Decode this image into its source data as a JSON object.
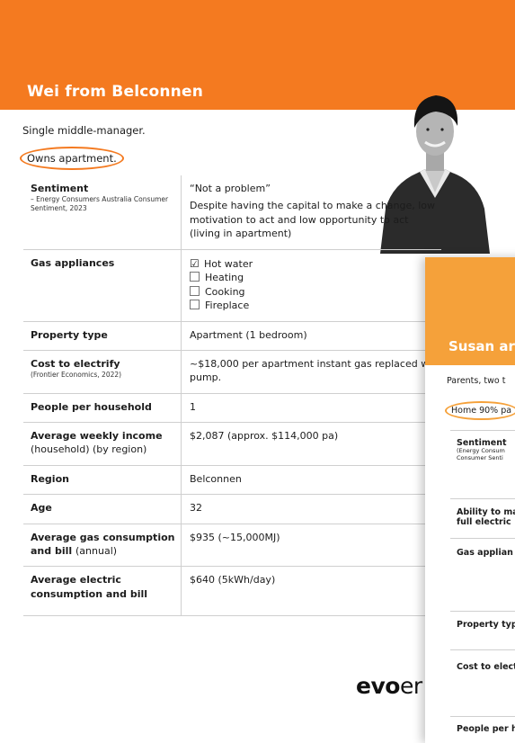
{
  "page1": {
    "title": "Wei from Belconnen",
    "subtitle": "Single middle-manager.",
    "circled": "Owns apartment.",
    "rows": {
      "sentiment": {
        "label": "Sentiment",
        "source": "– Energy Consumers Australia Consumer Sentiment, 2023",
        "quote": "“Not a problem”",
        "text": "Despite having the capital to make a change, low motivation to act and low opportunity to act (living in apartment)"
      },
      "gas": {
        "label": "Gas appliances",
        "items": [
          "Hot water",
          "Heating",
          "Cooking",
          "Fireplace"
        ]
      },
      "property": {
        "label": "Property type",
        "value": "Apartment (1 bedroom)"
      },
      "cost": {
        "label": "Cost to electrify",
        "source": "(Frontier Economics, 2022)",
        "value": "~$18,000 per apartment instant gas replaced w pump."
      },
      "people": {
        "label": "People per household",
        "value": "1"
      },
      "income": {
        "label": "Average weekly income",
        "label_extra": "(household) (by region)",
        "value": "$2,087 (approx. $114,000 pa)"
      },
      "region": {
        "label": "Region",
        "value": "Belconnen"
      },
      "age": {
        "label": "Age",
        "value": "32"
      },
      "gasbill": {
        "label": "Average gas consumption and bill",
        "label_extra": "(annual)",
        "value": "$935 (~15,000MJ)"
      },
      "elec": {
        "label": "Average electric consumption and bill",
        "value": "$640 (5kWh/day)"
      }
    },
    "logo_bold": "evo",
    "logo_rest": "er"
  },
  "page2": {
    "title": "Susan ar",
    "subtitle": "Parents, two t",
    "circled": "Home 90% pa",
    "sentiment": "Sentiment",
    "sentiment_src1": "(Energy Consum",
    "sentiment_src2": "Consumer Senti",
    "ability1": "Ability to ma",
    "ability2": "full electric",
    "gas": "Gas applian",
    "property": "Property typ",
    "cost": "Cost to elect",
    "people": "People per h"
  },
  "colors": {
    "accent": "#f47a20",
    "accent2": "#f5a13a"
  }
}
